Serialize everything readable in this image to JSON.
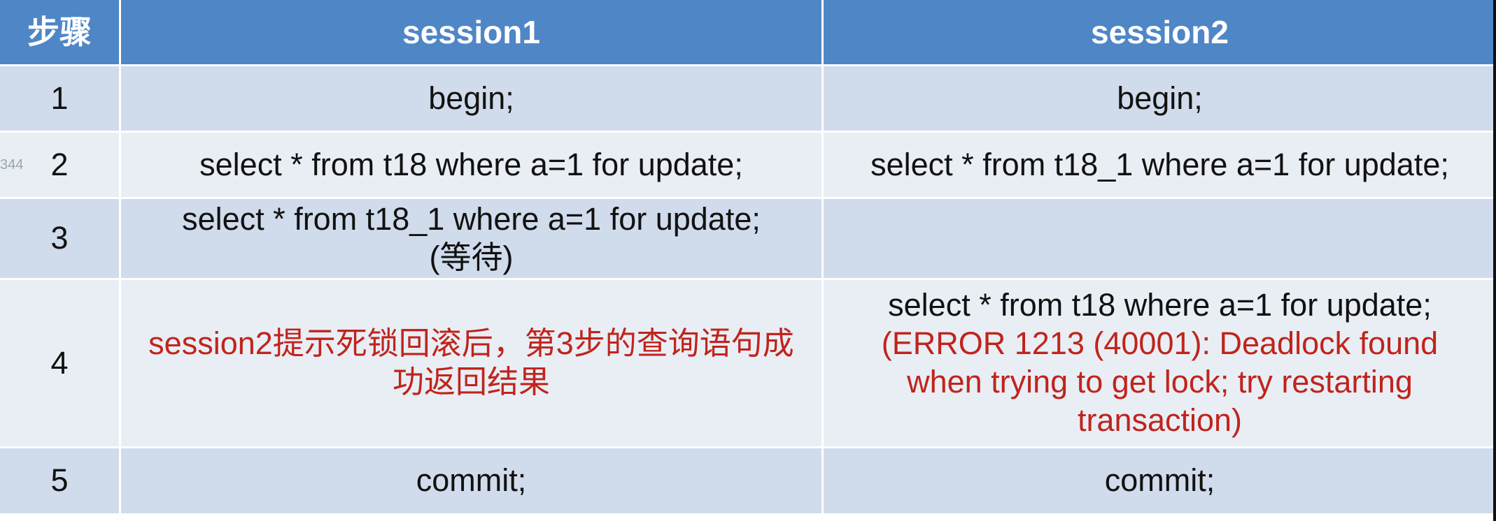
{
  "header": {
    "step": "步骤",
    "session1": "session1",
    "session2": "session2"
  },
  "side_mark": "344",
  "rows": [
    {
      "step": "1",
      "session1": [
        "begin;"
      ],
      "session2": [
        "begin;"
      ]
    },
    {
      "step": "2",
      "session1": [
        "select * from t18 where a=1 for update;"
      ],
      "session2": [
        "select * from t18_1 where a=1 for update;"
      ]
    },
    {
      "step": "3",
      "session1": [
        "select * from t18_1 where a=1 for update;",
        "(等待)"
      ],
      "session2": []
    },
    {
      "step": "4",
      "session1": [
        "session2提示死锁回滚后，第3步的查询语句成",
        "功返回结果"
      ],
      "session2": [
        "select * from t18 where a=1 for update;",
        "(ERROR 1213 (40001): Deadlock found",
        "when trying to get lock; try restarting",
        "transaction)"
      ]
    },
    {
      "step": "5",
      "session1": [
        "commit;"
      ],
      "session2": [
        "commit;"
      ]
    }
  ],
  "colors": {
    "header_bg": "#4f86c6",
    "row_dark": "#d0dbeb",
    "row_light": "#e9eef5",
    "error_text": "#c0241c"
  }
}
